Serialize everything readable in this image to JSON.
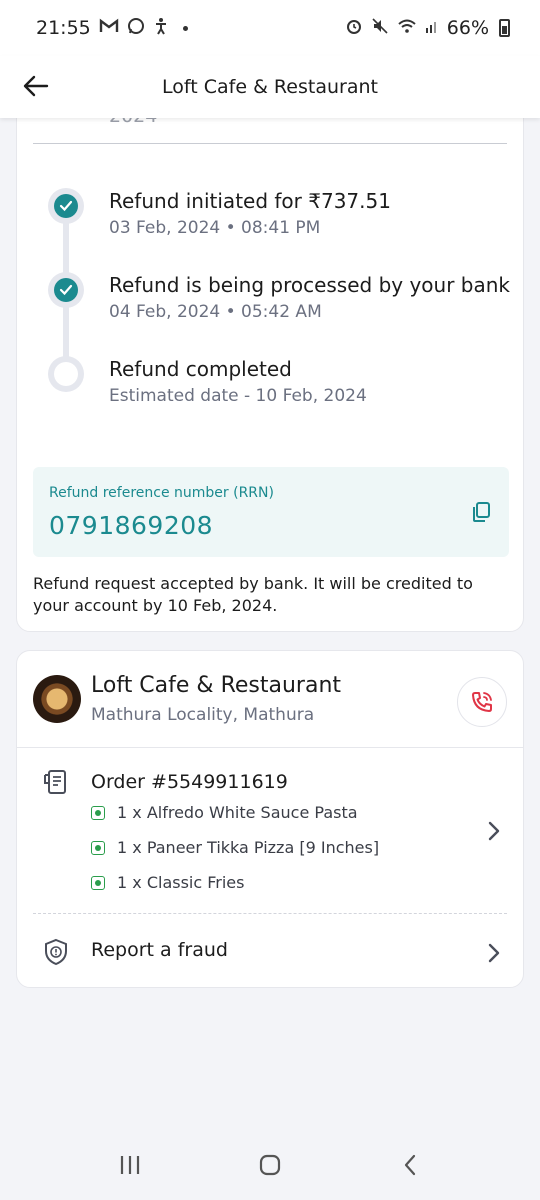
{
  "status_bar": {
    "time": "21:55",
    "notification_icons": [
      "gmail-icon",
      "whatsapp-icon",
      "accessibility-icon"
    ],
    "system_icons": [
      "alarm-icon",
      "mute-icon",
      "wifi-icon",
      "signal-icon"
    ],
    "battery_text": "66%"
  },
  "header": {
    "title": "Loft Cafe & Restaurant",
    "back_icon": "arrow-left-icon"
  },
  "refund": {
    "cut_off_text": "2024",
    "steps": [
      {
        "title": "Refund initiated for ₹737.51",
        "subtitle": "03 Feb, 2024 • 08:41 PM",
        "status": "done"
      },
      {
        "title": "Refund is being processed by your bank",
        "subtitle": "04 Feb, 2024 • 05:42 AM",
        "status": "done"
      },
      {
        "title": "Refund completed",
        "subtitle": "Estimated date - 10 Feb, 2024",
        "status": "pending"
      }
    ],
    "rrn_label": "Refund reference number (RRN)",
    "rrn_value": "0791869208",
    "note": "Refund request accepted by bank. It will be credited to your account by 10 Feb, 2024."
  },
  "restaurant": {
    "name": "Loft Cafe & Restaurant",
    "locality": "Mathura Locality, Mathura",
    "order_title": "Order #5549911619",
    "items": [
      "1 x Alfredo White Sauce Pasta",
      "1 x Paneer Tikka Pizza [9 Inches]",
      "1 x Classic Fries"
    ],
    "report_label": "Report a fraud"
  },
  "colors": {
    "accent": "#1b8a8f",
    "veg": "#2a9d4b",
    "call": "#e03546"
  }
}
